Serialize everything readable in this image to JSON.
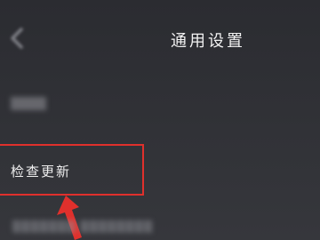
{
  "header": {
    "title": "通用设置",
    "back_icon": "chevron-left-icon"
  },
  "items": [
    {
      "label": "检查更新"
    }
  ],
  "colors": {
    "background": "#2f3035",
    "highlight_box": "#e0302c",
    "arrow": "#e0302c",
    "title_text": "#f2f2f2"
  }
}
